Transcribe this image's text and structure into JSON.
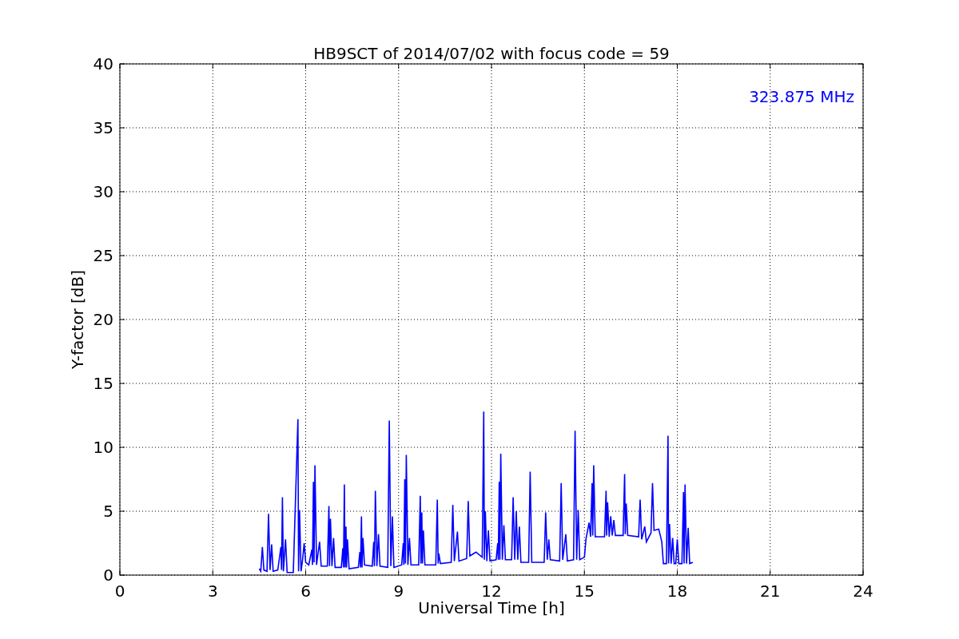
{
  "chart_data": {
    "type": "line",
    "title": "HB9SCT of 2014/07/02 with focus code = 59",
    "xlabel": "Universal Time [h]",
    "ylabel": "Y-factor [dB]",
    "xlim": [
      0,
      24
    ],
    "ylim": [
      0,
      40
    ],
    "xticks": [
      0,
      3,
      6,
      9,
      12,
      15,
      18,
      21,
      24
    ],
    "yticks": [
      0,
      5,
      10,
      15,
      20,
      25,
      30,
      35,
      40
    ],
    "grid": true,
    "x": [
      4.5,
      4.55,
      4.6,
      4.65,
      4.75,
      4.8,
      4.85,
      4.9,
      4.95,
      5.1,
      5.2,
      5.22,
      5.25,
      5.28,
      5.35,
      5.4,
      5.6,
      5.75,
      5.77,
      5.8,
      5.85,
      5.9,
      5.95,
      6.0,
      6.1,
      6.2,
      6.22,
      6.25,
      6.27,
      6.3,
      6.35,
      6.45,
      6.5,
      6.7,
      6.75,
      6.77,
      6.8,
      6.85,
      6.9,
      6.95,
      7.15,
      7.2,
      7.22,
      7.25,
      7.27,
      7.3,
      7.32,
      7.35,
      7.4,
      7.7,
      7.75,
      7.77,
      7.8,
      7.82,
      7.85,
      7.9,
      8.15,
      8.2,
      8.22,
      8.25,
      8.3,
      8.35,
      8.4,
      8.65,
      8.7,
      8.75,
      8.8,
      8.85,
      9.1,
      9.15,
      9.17,
      9.2,
      9.22,
      9.25,
      9.3,
      9.35,
      9.4,
      9.65,
      9.7,
      9.72,
      9.75,
      9.77,
      9.8,
      9.85,
      10.2,
      10.25,
      10.28,
      10.3,
      10.35,
      10.7,
      10.75,
      10.8,
      10.9,
      10.95,
      11.2,
      11.25,
      11.3,
      11.5,
      11.7,
      11.75,
      11.77,
      11.8,
      11.85,
      11.9,
      11.95,
      12.15,
      12.2,
      12.22,
      12.25,
      12.27,
      12.3,
      12.35,
      12.4,
      12.45,
      12.65,
      12.7,
      12.75,
      12.8,
      12.85,
      12.9,
      12.95,
      13.2,
      13.25,
      13.3,
      13.7,
      13.75,
      13.8,
      13.85,
      13.9,
      14.2,
      14.25,
      14.3,
      14.4,
      14.45,
      14.65,
      14.7,
      14.75,
      14.8,
      14.85,
      15.0,
      15.05,
      15.15,
      15.2,
      15.25,
      15.27,
      15.3,
      15.35,
      15.65,
      15.7,
      15.72,
      15.75,
      15.8,
      15.85,
      15.9,
      15.95,
      16.0,
      16.25,
      16.3,
      16.32,
      16.35,
      16.4,
      16.75,
      16.8,
      16.85,
      16.95,
      17.0,
      17.15,
      17.2,
      17.25,
      17.4,
      17.5,
      17.55,
      17.65,
      17.7,
      17.72,
      17.75,
      17.8,
      17.85,
      17.9,
      17.95,
      18.0,
      18.05,
      18.15,
      18.2,
      18.22,
      18.25,
      18.3,
      18.35,
      18.4,
      18.5
    ],
    "series": [
      {
        "name": "323.875 MHz",
        "color": "#0000ff",
        "values": [
          0.5,
          0.3,
          2.2,
          0.4,
          0.3,
          4.8,
          0.4,
          2.4,
          0.3,
          0.4,
          2.2,
          0.4,
          6.1,
          0.3,
          2.8,
          0.2,
          0.2,
          12.2,
          0.3,
          5.1,
          0.3,
          1.2,
          2.5,
          1.0,
          0.8,
          2.0,
          0.8,
          7.3,
          1.0,
          8.6,
          0.8,
          2.6,
          0.7,
          0.7,
          5.4,
          0.7,
          4.4,
          0.7,
          2.9,
          0.6,
          0.6,
          2.1,
          0.6,
          7.1,
          0.6,
          3.8,
          0.6,
          2.8,
          0.5,
          0.6,
          1.8,
          0.6,
          4.6,
          0.6,
          2.9,
          0.8,
          0.7,
          2.6,
          0.7,
          6.6,
          0.7,
          3.2,
          0.7,
          0.6,
          12.1,
          0.7,
          4.6,
          0.6,
          0.8,
          2.5,
          0.8,
          7.5,
          0.9,
          9.4,
          0.8,
          2.9,
          0.8,
          0.8,
          6.2,
          0.9,
          4.9,
          0.9,
          3.5,
          0.8,
          0.8,
          5.9,
          0.9,
          1.7,
          0.9,
          1.0,
          5.5,
          1.1,
          3.4,
          1.1,
          1.3,
          5.8,
          1.5,
          1.8,
          1.4,
          12.8,
          1.2,
          5.0,
          1.1,
          3.5,
          1.1,
          1.2,
          2.5,
          1.2,
          7.3,
          1.2,
          9.5,
          1.2,
          3.9,
          1.2,
          1.2,
          6.1,
          1.2,
          5.0,
          1.2,
          3.8,
          1.0,
          1.0,
          8.1,
          1.0,
          1.0,
          4.9,
          1.2,
          2.8,
          1.2,
          1.1,
          7.2,
          1.2,
          3.2,
          1.1,
          1.2,
          11.3,
          1.2,
          5.1,
          1.2,
          1.4,
          2.8,
          4.1,
          3.0,
          7.2,
          3.1,
          8.6,
          3.0,
          3.0,
          6.6,
          3.1,
          5.7,
          3.0,
          4.6,
          3.1,
          4.3,
          3.1,
          3.1,
          7.9,
          3.2,
          5.6,
          3.1,
          3.0,
          5.9,
          2.8,
          3.8,
          2.6,
          3.3,
          7.2,
          3.5,
          3.6,
          2.6,
          0.9,
          0.9,
          10.9,
          0.9,
          4.0,
          0.9,
          2.9,
          0.9,
          0.9,
          2.8,
          0.9,
          0.9,
          6.5,
          0.9,
          7.1,
          0.9,
          3.7,
          0.9,
          1.0
        ]
      }
    ]
  }
}
